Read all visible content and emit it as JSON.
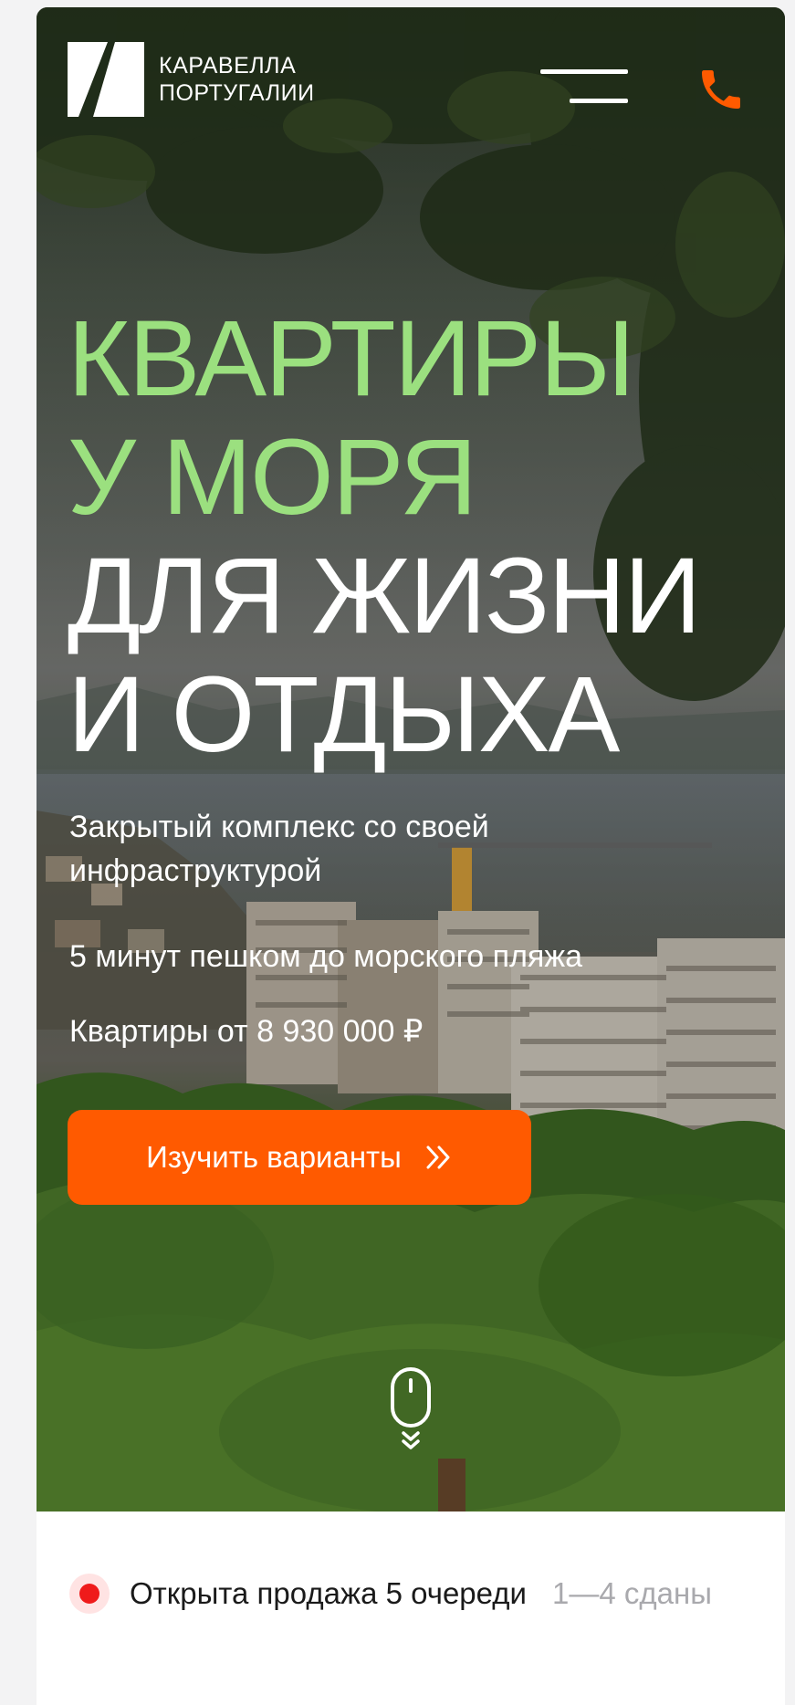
{
  "header": {
    "brand_line1": "КАРАВЕЛЛА",
    "brand_line2": "ПОРТУГАЛИИ",
    "menu_icon": "hamburger-menu-icon",
    "phone_icon": "phone-icon"
  },
  "hero": {
    "headline_line1": "КВАРТИРЫ",
    "headline_line2": "У МОРЯ",
    "headline_line3": "ДЛЯ ЖИЗНИ",
    "headline_line4": "И ОТДЫХА",
    "feature1": "Закрытый комплекс со своей инфраструктурой",
    "feature2": "5 минут пешком до морского пляжа",
    "feature3": "Квартиры от 8 930 000 ₽",
    "cta_label": "Изучить варианты",
    "cta_icon": "double-chevron-right-icon",
    "scroll_icon": "mouse-scroll-icon"
  },
  "status": {
    "main": "Открыта продажа 5 очереди",
    "sub": "1—4 сданы"
  },
  "colors": {
    "accent_green": "#9be07f",
    "accent_orange": "#ff5a00",
    "status_red": "#ef1b1b"
  }
}
